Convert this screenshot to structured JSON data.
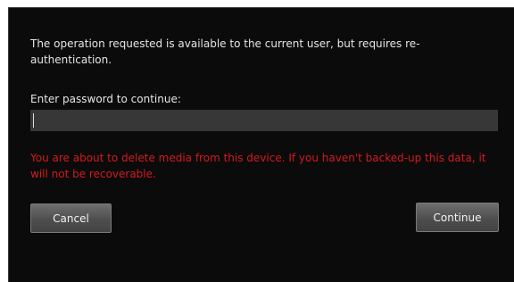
{
  "dialog": {
    "message": "The operation requested is available to the current user, but requires re-authentication.",
    "password_label": "Enter password to continue:",
    "password_value": "",
    "warning": "You are about to delete media from this device. If you haven't backed-up this data, it will not be recoverable.",
    "cancel_label": "Cancel",
    "continue_label": "Continue"
  },
  "colors": {
    "background": "#0b0b0b",
    "text": "#e6e6e6",
    "warning": "#d7191c",
    "input_bg": "#373737"
  }
}
